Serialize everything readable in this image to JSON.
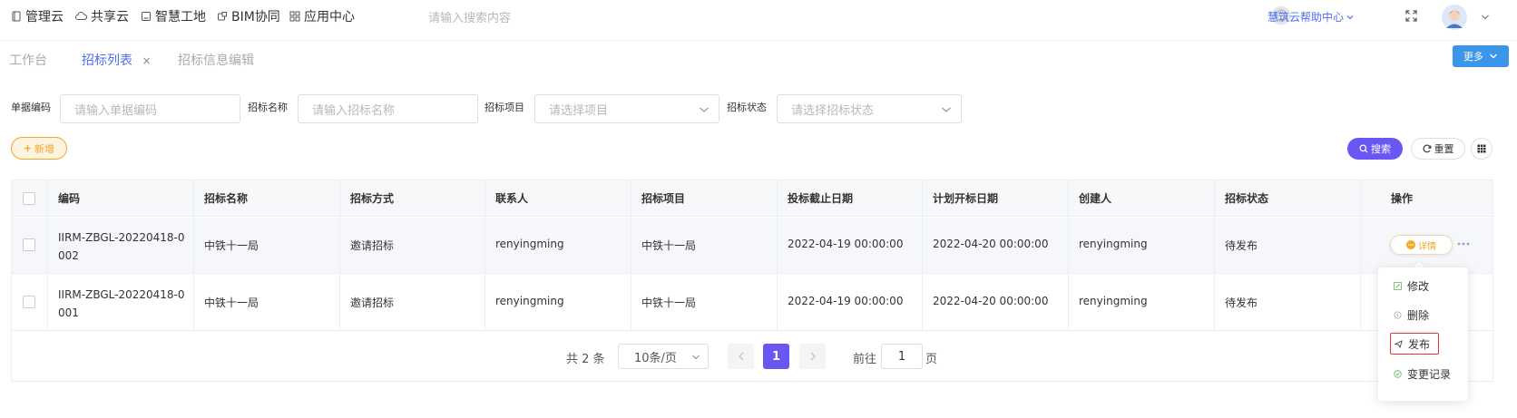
{
  "topnav": {
    "items": [
      {
        "label": "管理云",
        "icon": "book-icon"
      },
      {
        "label": "共享云",
        "icon": "cloud-icon"
      },
      {
        "label": "智慧工地",
        "icon": "monitor-icon"
      },
      {
        "label": "BIM协同",
        "icon": "cube-icon"
      },
      {
        "label": "应用中心",
        "icon": "apps-grid-icon"
      }
    ],
    "search_placeholder": "请输入搜索内容",
    "help_label": "慧筑云帮助中心"
  },
  "tabs": [
    {
      "label": "工作台",
      "active": false
    },
    {
      "label": "招标列表",
      "active": true,
      "close": "×"
    },
    {
      "label": "招标信息编辑",
      "active": false
    }
  ],
  "more_label": "更多",
  "filters": {
    "code_label": "单据编码",
    "code_placeholder": "请输入单据编码",
    "name_label": "招标名称",
    "name_placeholder": "请输入招标名称",
    "project_label": "招标项目",
    "project_placeholder": "请选择项目",
    "status_label": "招标状态",
    "status_placeholder": "请选择招标状态"
  },
  "actions": {
    "add_label": "新增",
    "search_label": "搜索",
    "reset_label": "重置"
  },
  "table": {
    "columns": [
      "编码",
      "招标名称",
      "招标方式",
      "联系人",
      "招标项目",
      "投标截止日期",
      "计划开标日期",
      "创建人",
      "招标状态",
      "操作"
    ],
    "rows": [
      {
        "code_line1": "IIRM-ZBGL-20220418-0",
        "code_line2": "002",
        "name": "中铁十一局",
        "method": "邀请招标",
        "contact": "renyingming",
        "project": "中铁十一局",
        "deadline": "2022-04-19 00:00:00",
        "open_date": "2022-04-20 00:00:00",
        "creator": "renyingming",
        "status": "待发布"
      },
      {
        "code_line1": "IIRM-ZBGL-20220418-0",
        "code_line2": "001",
        "name": "中铁十一局",
        "method": "邀请招标",
        "contact": "renyingming",
        "project": "中铁十一局",
        "deadline": "2022-04-19 00:00:00",
        "open_date": "2022-04-20 00:00:00",
        "creator": "renyingming",
        "status": "待发布"
      }
    ],
    "detail_label": "详情"
  },
  "pagination": {
    "total_text": "共 2 条",
    "page_size": "10条/页",
    "current_page": "1",
    "goto_label": "前往",
    "goto_value": "1",
    "page_unit": "页"
  },
  "row_menu": {
    "items": [
      {
        "label": "修改",
        "icon": "edit-icon"
      },
      {
        "label": "删除",
        "icon": "delete-icon"
      },
      {
        "label": "发布",
        "icon": "send-icon"
      },
      {
        "label": "变更记录",
        "icon": "history-icon"
      }
    ]
  },
  "colors": {
    "primary": "#6a57f3",
    "link": "#4e6ef2",
    "accent_orange": "#f5a623",
    "more_button": "#3b95e8"
  }
}
